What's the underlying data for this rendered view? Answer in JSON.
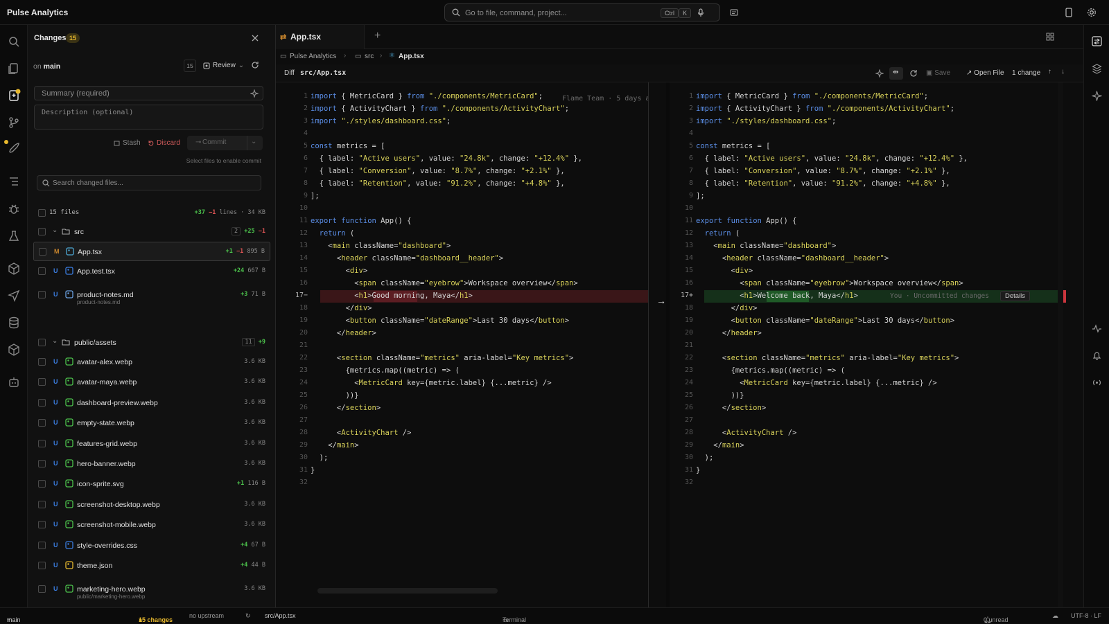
{
  "app": {
    "title": "Pulse Analytics"
  },
  "command_bar": {
    "placeholder": "Go to file, command, project...",
    "kbd1": "Ctrl",
    "kbd2": "K"
  },
  "changes_panel": {
    "title": "Changes",
    "count_badge": "15",
    "branch_prefix": "on",
    "branch": "main",
    "review_count": "15",
    "review_label": "Review",
    "summary_placeholder": "Summary (required)",
    "description_placeholder": "Description (optional)",
    "stash_label": "Stash",
    "discard_label": "Discard",
    "commit_label": "Commit",
    "commit_hint": "Select files to enable commit",
    "search_placeholder": "Search changed files...",
    "totals": {
      "label": "15 files",
      "added": "+37",
      "removed": "−1",
      "lines": "lines",
      "size": "· 34 KB"
    },
    "groups": [
      {
        "name": "src",
        "count": "2",
        "added": "+25",
        "removed": "−1"
      },
      {
        "name": "public/assets",
        "count": "11",
        "added": "+9"
      }
    ],
    "files": [
      {
        "status": "M",
        "name": "App.tsx",
        "added": "+1",
        "removed": "−1",
        "size": "895 B",
        "icon": "react-icon",
        "selected": true
      },
      {
        "status": "U",
        "name": "App.test.tsx",
        "added": "+24",
        "size": "667 B",
        "icon": "check-icon"
      },
      {
        "status": "U",
        "name": "product-notes.md",
        "path": "product-notes.md",
        "added": "+3",
        "size": "71 B",
        "icon": "markdown-icon"
      },
      {
        "status": "U",
        "name": "avatar-alex.webp",
        "size": "3.6 KB",
        "icon": "image-icon"
      },
      {
        "status": "U",
        "name": "avatar-maya.webp",
        "size": "3.6 KB",
        "icon": "image-icon"
      },
      {
        "status": "U",
        "name": "dashboard-preview.webp",
        "size": "3.6 KB",
        "icon": "image-icon"
      },
      {
        "status": "U",
        "name": "empty-state.webp",
        "size": "3.6 KB",
        "icon": "image-icon"
      },
      {
        "status": "U",
        "name": "features-grid.webp",
        "size": "3.6 KB",
        "icon": "image-icon"
      },
      {
        "status": "U",
        "name": "hero-banner.webp",
        "size": "3.6 KB",
        "icon": "image-icon"
      },
      {
        "status": "U",
        "name": "icon-sprite.svg",
        "added": "+1",
        "size": "116 B",
        "icon": "image-icon"
      },
      {
        "status": "U",
        "name": "screenshot-desktop.webp",
        "size": "3.6 KB",
        "icon": "image-icon"
      },
      {
        "status": "U",
        "name": "screenshot-mobile.webp",
        "size": "3.6 KB",
        "icon": "image-icon"
      },
      {
        "status": "U",
        "name": "style-overrides.css",
        "added": "+4",
        "size": "67 B",
        "icon": "css-icon"
      },
      {
        "status": "U",
        "name": "theme.json",
        "added": "+4",
        "size": "44 B",
        "icon": "json-icon"
      },
      {
        "status": "U",
        "name": "marketing-hero.webp",
        "path": "public/marketing-hero.webp",
        "size": "3.6 KB",
        "icon": "image-icon"
      }
    ]
  },
  "editor": {
    "tab_label": "App.tsx",
    "breadcrumb": [
      "Pulse Analytics",
      "src",
      "App.tsx"
    ],
    "diff_label": "Diff",
    "diff_path": "src/App.tsx",
    "save_label": "Save",
    "open_file_label": "Open File",
    "change_count": "1 change",
    "blame_left": "Flame Team · 5 days a",
    "blame_right": "You · Uncommitted changes",
    "details_label": "Details",
    "left_changed_line": "17−",
    "right_changed_line": "17+",
    "left_lines": [
      "import { MetricCard } from \"./components/MetricCard\";",
      "import { ActivityChart } from \"./components/ActivityChart\";",
      "import \"./styles/dashboard.css\";",
      "",
      "const metrics = [",
      "  { label: \"Active users\", value: \"24.8k\", change: \"+12.4%\" },",
      "  { label: \"Conversion\", value: \"8.7%\", change: \"+2.1%\" },",
      "  { label: \"Retention\", value: \"91.2%\", change: \"+4.8%\" },",
      "];",
      "",
      "export function App() {",
      "  return (",
      "    <main className=\"dashboard\">",
      "      <header className=\"dashboard__header\">",
      "        <div>",
      "          <span className=\"eyebrow\">Workspace overview</span>",
      "          <h1>Good morning, Maya</h1>",
      "        </div>",
      "        <button className=\"dateRange\">Last 30 days</button>",
      "      </header>",
      "",
      "      <section className=\"metrics\" aria-label=\"Key metrics\">",
      "        {metrics.map((metric) => (",
      "          <MetricCard key={metric.label} {...metric} />",
      "        ))}",
      "      </section>",
      "",
      "      <ActivityChart />",
      "    </main>",
      "  );",
      "}",
      ""
    ],
    "right_lines": [
      "import { MetricCard } from \"./components/MetricCard\";",
      "import { ActivityChart } from \"./components/ActivityChart\";",
      "import \"./styles/dashboard.css\";",
      "",
      "const metrics = [",
      "  { label: \"Active users\", value: \"24.8k\", change: \"+12.4%\" },",
      "  { label: \"Conversion\", value: \"8.7%\", change: \"+2.1%\" },",
      "  { label: \"Retention\", value: \"91.2%\", change: \"+4.8%\" },",
      "];",
      "",
      "export function App() {",
      "  return (",
      "    <main className=\"dashboard\">",
      "      <header className=\"dashboard__header\">",
      "        <div>",
      "          <span className=\"eyebrow\">Workspace overview</span>",
      "          <h1>Welcome back, Maya</h1>",
      "        </div>",
      "        <button className=\"dateRange\">Last 30 days</button>",
      "      </header>",
      "",
      "      <section className=\"metrics\" aria-label=\"Key metrics\">",
      "        {metrics.map((metric) => (",
      "          <MetricCard key={metric.label} {...metric} />",
      "        ))}",
      "      </section>",
      "",
      "      <ActivityChart />",
      "    </main>",
      "  );",
      "}",
      ""
    ]
  },
  "statusbar": {
    "branch": "main",
    "changes": "15 changes",
    "upstream": "no upstream",
    "file": "src/App.tsx",
    "terminal": "Terminal",
    "unread": "0 unread",
    "encoding": "UTF-8 · LF"
  },
  "colors": {
    "accent": "#e8b92e",
    "added": "#4cc24c",
    "removed": "#e05555",
    "keyword": "#5b8ee6",
    "string": "#d9d25a"
  }
}
